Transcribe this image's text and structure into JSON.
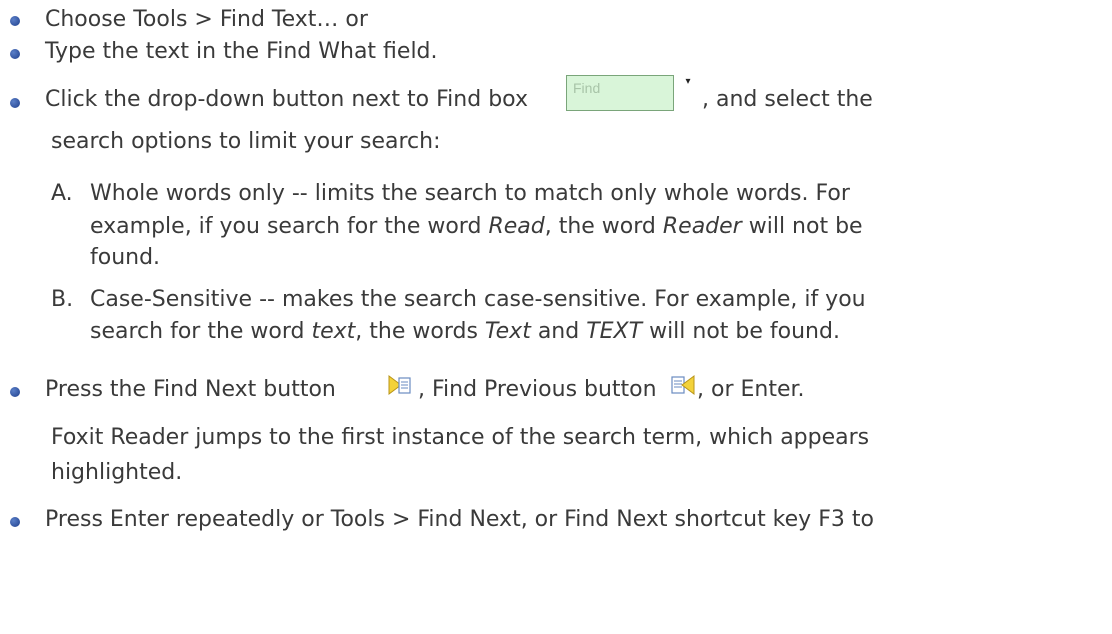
{
  "bullets": {
    "b1": "Choose Tools > Find Text… or",
    "b2": "Type the text in the Find What field.",
    "b3_pre": "Click the drop-down button next to Find box",
    "b3_post": ", and select the",
    "b3_line2": "search options to limit your search:",
    "find_box_text": "Find",
    "b4_pre": "Press the Find Next button",
    "b4_mid": ", Find Previous button",
    "b4_post": ", or Enter.",
    "b4_para1": "Foxit Reader jumps to the first instance of the search term, which appears",
    "b4_para2": "highlighted.",
    "b5": "Press Enter repeatedly or Tools > Find Next, or Find Next shortcut key F3 to"
  },
  "options": {
    "a_marker": "A.",
    "a1_pre": "Whole words only -- limits the search to match only whole words. For",
    "a2_pre": "example, if you search for the word ",
    "a2_em1": "Read",
    "a2_mid": ", the word ",
    "a2_em2": "Reader",
    "a2_post": " will not be",
    "a3": "found.",
    "b_marker": "B.",
    "b1": "Case-Sensitive -- makes the search case-sensitive. For example, if you",
    "b2_pre": "search for the word ",
    "b2_em1": "text",
    "b2_mid": ", the words ",
    "b2_em2": "Text",
    "b2_and": " and ",
    "b2_em3": "TEXT",
    "b2_post": " will not be found."
  },
  "icons": {
    "find_next": "find-next-icon",
    "find_previous": "find-previous-icon",
    "dropdown": "dropdown-arrow-icon"
  },
  "colors": {
    "bullet": "#2a4f9f",
    "find_box_bg": "#d9f5d9",
    "text": "#3a3a3a"
  }
}
